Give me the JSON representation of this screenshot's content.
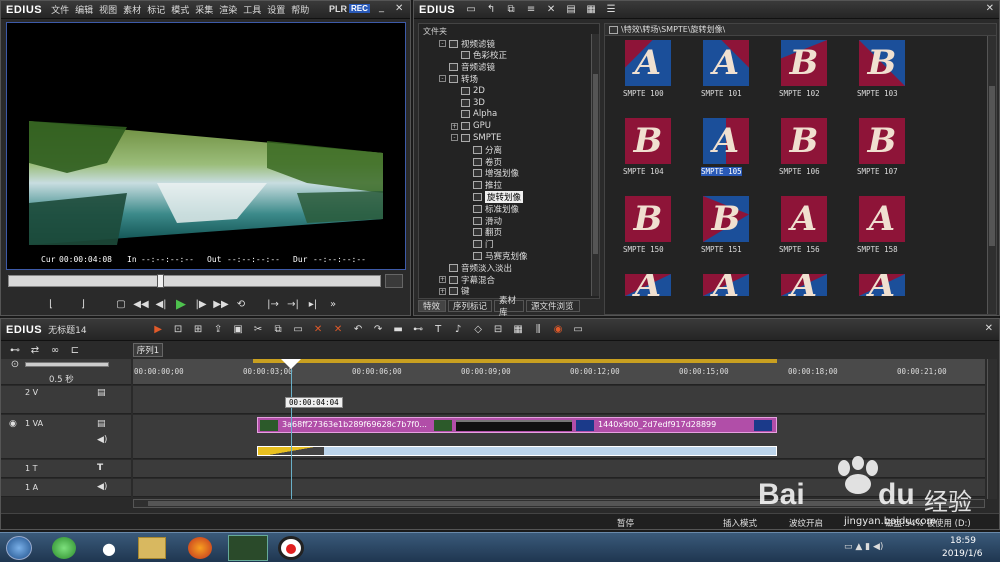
{
  "player": {
    "logo": "EDIUS",
    "menu": [
      "文件",
      "编辑",
      "视图",
      "素材",
      "标记",
      "模式",
      "采集",
      "渲染",
      "工具",
      "设置",
      "帮助"
    ],
    "plr": "PLR",
    "rec": "REC",
    "cur_label": "Cur",
    "cur_value": "00:00:04:08",
    "in_label": "In",
    "in_value": "--:--:--:--",
    "out_label": "Out",
    "out_value": "--:--:--:--",
    "dur_label": "Dur",
    "dur_value": "--:--:--:--"
  },
  "bin": {
    "logo": "EDIUS",
    "folder_header": "文件夹",
    "path": "\\特效\\转场\\SMPTE\\旋转划像\\",
    "tree": [
      {
        "label": "视频滤镜",
        "indent": 1,
        "exp": "-"
      },
      {
        "label": "色彩校正",
        "indent": 2,
        "exp": ""
      },
      {
        "label": "音频滤镜",
        "indent": 1,
        "exp": ""
      },
      {
        "label": "转场",
        "indent": 1,
        "exp": "-"
      },
      {
        "label": "2D",
        "indent": 2,
        "exp": ""
      },
      {
        "label": "3D",
        "indent": 2,
        "exp": ""
      },
      {
        "label": "Alpha",
        "indent": 2,
        "exp": ""
      },
      {
        "label": "GPU",
        "indent": 2,
        "exp": "+"
      },
      {
        "label": "SMPTE",
        "indent": 2,
        "exp": "-"
      },
      {
        "label": "分离",
        "indent": 3,
        "exp": ""
      },
      {
        "label": "卷页",
        "indent": 3,
        "exp": ""
      },
      {
        "label": "增强划像",
        "indent": 3,
        "exp": ""
      },
      {
        "label": "推拉",
        "indent": 3,
        "exp": ""
      },
      {
        "label": "旋转划像",
        "indent": 3,
        "exp": "",
        "selected": true
      },
      {
        "label": "标准划像",
        "indent": 3,
        "exp": ""
      },
      {
        "label": "滑动",
        "indent": 3,
        "exp": ""
      },
      {
        "label": "翻页",
        "indent": 3,
        "exp": ""
      },
      {
        "label": "门",
        "indent": 3,
        "exp": ""
      },
      {
        "label": "马赛克划像",
        "indent": 3,
        "exp": ""
      },
      {
        "label": "音频淡入淡出",
        "indent": 1,
        "exp": ""
      },
      {
        "label": "字幕混合",
        "indent": 1,
        "exp": "+"
      },
      {
        "label": "键",
        "indent": 1,
        "exp": "+"
      }
    ],
    "tabs": [
      "特效",
      "序列标记",
      "素材库",
      "源文件浏览"
    ],
    "thumbs": [
      {
        "letter": "A",
        "label": "SMPTE  100"
      },
      {
        "letter": "A",
        "label": "SMPTE  101"
      },
      {
        "letter": "B",
        "label": "SMPTE  102"
      },
      {
        "letter": "B",
        "label": "SMPTE  103"
      },
      {
        "letter": "B",
        "label": "SMPTE  104"
      },
      {
        "letter": "A",
        "label": "SMPTE  105",
        "selected": true
      },
      {
        "letter": "B",
        "label": "SMPTE  106"
      },
      {
        "letter": "B",
        "label": "SMPTE  107"
      },
      {
        "letter": "B",
        "label": "SMPTE  150"
      },
      {
        "letter": "B",
        "label": "SMPTE  151"
      },
      {
        "letter": "A",
        "label": "SMPTE  156"
      },
      {
        "letter": "A",
        "label": "SMPTE  158"
      },
      {
        "letter": "A",
        "label": ""
      },
      {
        "letter": "A",
        "label": ""
      },
      {
        "letter": "A",
        "label": ""
      },
      {
        "letter": "A",
        "label": ""
      }
    ]
  },
  "timeline": {
    "logo": "EDIUS",
    "project": "无标题14",
    "sequence_tab": "序列1",
    "scale": "0.5 秒",
    "ticks": [
      "00:00:00;00",
      "00:00:03;00",
      "00:00:06;00",
      "00:00:09;00",
      "00:00:12;00",
      "00:00:15;00",
      "00:00:18;00",
      "00:00:21;00"
    ],
    "cursor_time": "00:00:04:04",
    "tracks": [
      {
        "name": "2 V"
      },
      {
        "name": "1 VA"
      },
      {
        "name": "1 T"
      },
      {
        "name": "1 A"
      }
    ],
    "clip1": "3a68ff27363e1b289f69628c7b7f0...",
    "clip2": "1440x900_2d7edf917d28899",
    "status": [
      "暂停",
      "插入模式",
      "波纹开启",
      "",
      "磁盘:54% 被使用 (D:)"
    ]
  },
  "taskbar": {
    "time": "18:59",
    "date": "2019/1/6"
  },
  "watermark": {
    "brand": "Bai",
    "brand2": "du",
    "jingyan": "经验",
    "url": "jingyan.baidu.com"
  }
}
